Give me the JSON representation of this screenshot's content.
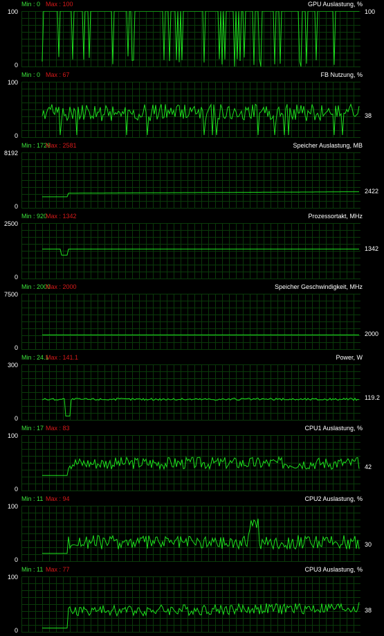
{
  "panels": [
    {
      "min": "Min : 0",
      "max": "Max : 100",
      "title": "GPU Auslastung, %",
      "ymax": "100",
      "ymin": "0",
      "current": "100",
      "scale_max": 100,
      "current_value": 100,
      "line_color": "#1ee11e"
    },
    {
      "min": "Min : 0",
      "max": "Max : 67",
      "title": "FB Nutzung, %",
      "ymax": "100",
      "ymin": "0",
      "current": "38",
      "scale_max": 100,
      "current_value": 38,
      "line_color": "#1ee11e"
    },
    {
      "min": "Min : 1726",
      "max": "Max : 2581",
      "title": "Speicher Auslastung, MB",
      "ymax": "8192",
      "ymin": "0",
      "current": "2422",
      "scale_max": 8192,
      "current_value": 2422,
      "line_color": "#1ee11e"
    },
    {
      "min": "Min : 920",
      "max": "Max : 1342",
      "title": "Prozessortakt, MHz",
      "ymax": "2500",
      "ymin": "0",
      "current": "1342",
      "scale_max": 2500,
      "current_value": 1342,
      "line_color": "#1ee11e"
    },
    {
      "min": "Min : 2000",
      "max": "Max : 2000",
      "title": "Speicher Geschwindigkeit, MHz",
      "ymax": "7500",
      "ymin": "0",
      "current": "2000",
      "scale_max": 7500,
      "current_value": 2000,
      "line_color": "#1ee11e"
    },
    {
      "min": "Min : 24.1",
      "max": "Max : 141.1",
      "title": "Power, W",
      "ymax": "300",
      "ymin": "0",
      "current": "119.2",
      "scale_max": 300,
      "current_value": 119.2,
      "line_color": "#1ee11e"
    },
    {
      "min": "Min : 17",
      "max": "Max : 83",
      "title": "CPU1 Auslastung, %",
      "ymax": "100",
      "ymin": "0",
      "current": "42",
      "scale_max": 100,
      "current_value": 42,
      "line_color": "#1ee11e"
    },
    {
      "min": "Min : 11",
      "max": "Max : 94",
      "title": "CPU2 Auslastung, %",
      "ymax": "100",
      "ymin": "0",
      "current": "30",
      "scale_max": 100,
      "current_value": 30,
      "line_color": "#1ee11e"
    },
    {
      "min": "Min : 11",
      "max": "Max : 77",
      "title": "CPU3 Auslastung, %",
      "ymax": "100",
      "ymin": "0",
      "current": "38",
      "scale_max": 100,
      "current_value": 38,
      "line_color": "#1ee11e"
    }
  ],
  "colors": {
    "background": "#000000",
    "grid": "#0a3a0a",
    "min_label": "#3be23b",
    "max_label": "#d81a1a",
    "line": "#1ee11e"
  }
}
